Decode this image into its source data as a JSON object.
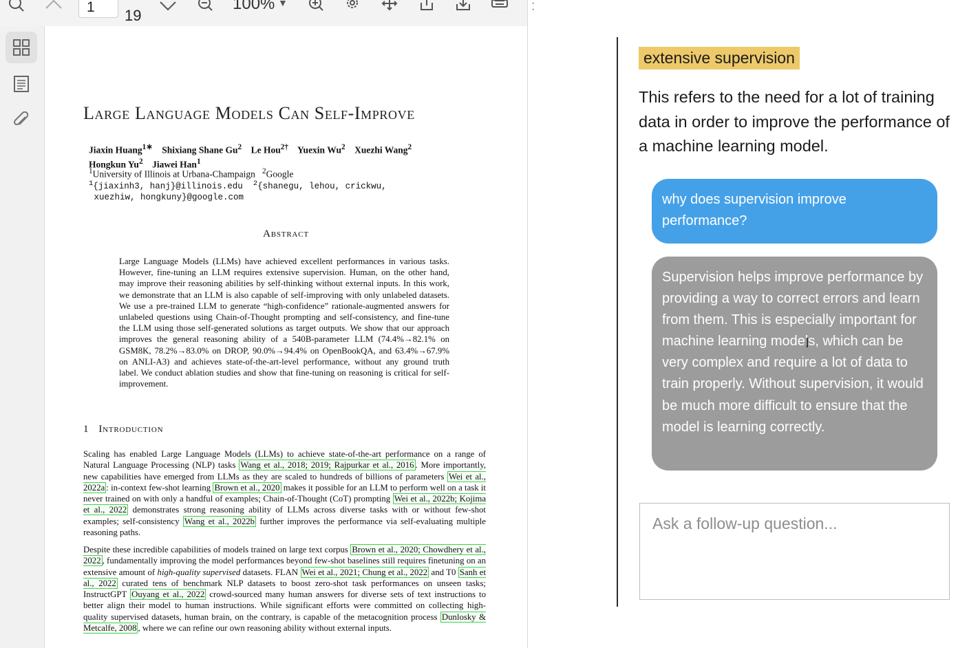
{
  "toolbar": {
    "page_current": "1",
    "page_total": "19",
    "zoom": "100%",
    "icons": [
      "search-icon",
      "chevron-up-icon",
      "chevron-down-icon",
      "zoom-out-icon",
      "zoom-in-icon",
      "gear-icon",
      "move-icon",
      "share-icon",
      "download-icon",
      "print-icon",
      "more-icon"
    ]
  },
  "sidebar": {
    "items": [
      {
        "icon": "thumbnails-icon",
        "active": true
      },
      {
        "icon": "outline-icon",
        "active": false
      },
      {
        "icon": "paperclip-icon",
        "active": false
      }
    ]
  },
  "paper": {
    "title": "Large Language Models Can Self-Improve",
    "authors": [
      {
        "name": "Jiaxin Huang",
        "sup": "1∗"
      },
      {
        "name": "Shixiang Shane Gu",
        "sup": "2"
      },
      {
        "name": "Le Hou",
        "sup": "2†"
      },
      {
        "name": "Yuexin Wu",
        "sup": "2"
      },
      {
        "name": "Xuezhi Wang",
        "sup": "2"
      },
      {
        "name": "Hongkun Yu",
        "sup": "2"
      },
      {
        "name": "Jiawei Han",
        "sup": "1"
      }
    ],
    "affiliation_1": "University of Illinois at Urbana-Champaign",
    "affiliation_2": "Google",
    "emails_line1": "{jiaxinh3, hanj}@illinois.edu",
    "emails_line1b": "{shanegu, lehou, crickwu,",
    "emails_line2": "xuezhiw, hongkuny}@google.com",
    "abstract_heading": "Abstract",
    "abstract": "Large Language Models (LLMs) have achieved excellent performances in various tasks. However, fine-tuning an LLM requires extensive supervision. Human, on the other hand, may improve their reasoning abilities by self-thinking without external inputs. In this work, we demonstrate that an LLM is also capable of self-improving with only unlabeled datasets. We use a pre-trained LLM to generate “high-confidence” rationale-augmented answers for unlabeled questions using Chain-of-Thought prompting and self-consistency, and fine-tune the LLM using those self-generated solutions as target outputs. We show that our approach improves the general reasoning ability of a 540B-parameter LLM (74.4%→82.1% on GSM8K, 78.2%→83.0% on DROP, 90.0%→94.4% on OpenBookQA, and 63.4%→67.9% on ANLI-A3) and achieves state-of-the-art-level performance, without any ground truth label. We conduct ablation studies and show that fine-tuning on reasoning is critical for self-improvement.",
    "section_number": "1",
    "section_title": "Introduction",
    "intro_p1": [
      {
        "t": "Scaling has enabled Large Language Models (LLMs) to achieve state-of-the-art performance on a range of Natural Language Processing (NLP) tasks "
      },
      {
        "c": "Wang et al., 2018; 2019; Rajpurkar et al., 2016"
      },
      {
        "t": ". More importantly, new capabilities have emerged from LLMs as they are scaled to hundreds of billions of parameters "
      },
      {
        "c": "Wei et al., 2022a"
      },
      {
        "t": ": in-context few-shot learning "
      },
      {
        "c": "Brown et al., 2020"
      },
      {
        "t": " makes it possible for an LLM to perform well on a task it never trained on with only a handful of examples; Chain-of-Thought (CoT) prompting "
      },
      {
        "c": "Wei et al., 2022b; Kojima et al., 2022"
      },
      {
        "t": " demonstrates strong reasoning ability of LLMs across diverse tasks with or without few-shot examples; self-consistency "
      },
      {
        "c": "Wang et al., 2022b"
      },
      {
        "t": " further improves the performance via self-evaluating multiple reasoning paths."
      }
    ],
    "intro_p2": [
      {
        "t": "Despite these incredible capabilities of models trained on large text corpus "
      },
      {
        "c": "Brown et al., 2020; Chowdhery et al., 2022"
      },
      {
        "t": ", fundamentally improving the model performances beyond few-shot baselines still requires finetuning on an extensive amount of "
      },
      {
        "i": "high-quality supervised"
      },
      {
        "t": " datasets. FLAN "
      },
      {
        "c": "Wei et al., 2021; Chung et al., 2022"
      },
      {
        "t": " and T0 "
      },
      {
        "c": "Sanh et al., 2022"
      },
      {
        "t": " curated tens of benchmark NLP datasets to boost zero-shot task performances on unseen tasks; InstructGPT "
      },
      {
        "c": "Ouyang et al., 2022"
      },
      {
        "t": " crowd-sourced many human answers for diverse sets of text instructions to better align their model to human instructions. While significant efforts were committed on collecting high-quality supervised datasets, human brain, on the contrary, is capable of the metacognition process "
      },
      {
        "c": "Dunlosky & Metcalfe, 2008"
      },
      {
        "t": ", where we can refine our own reasoning ability without external inputs."
      }
    ]
  },
  "panel": {
    "term": "extensive supervision",
    "definition": "This refers to the need for a lot of training data in order to improve the performance of a machine learning model.",
    "messages": [
      {
        "role": "user",
        "text": "why does supervision improve performance?"
      },
      {
        "role": "assistant",
        "text": "Supervision helps improve performance by providing a way to correct errors and learn from them. This is especially important for machine learning models, which can be very complex and require a lot of data to train properly. Without supervision, it would be much more difficult to ensure that the model is learning correctly."
      }
    ],
    "followup_placeholder": "Ask a follow-up question...",
    "colors": {
      "highlight": "#edc96a",
      "user_bubble": "#45a1e7",
      "assistant_bubble": "#9c9c9c"
    }
  }
}
